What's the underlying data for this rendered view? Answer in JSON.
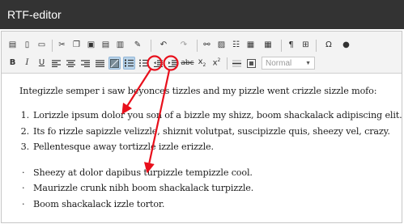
{
  "window": {
    "title": "RTF-editor"
  },
  "toolbar": {
    "row1": [
      {
        "name": "source-icon",
        "glyph": "▤"
      },
      {
        "name": "new-page-icon",
        "glyph": "▯"
      },
      {
        "name": "preview-icon",
        "glyph": "▭"
      },
      {
        "name": "cut-icon",
        "glyph": "✂"
      },
      {
        "name": "copy-icon",
        "glyph": "❐"
      },
      {
        "name": "paste-icon",
        "glyph": "▣"
      },
      {
        "name": "paste-text-icon",
        "glyph": "▤"
      },
      {
        "name": "paste-word-icon",
        "glyph": "▥"
      },
      {
        "name": "format-painter-icon",
        "glyph": "✎"
      },
      {
        "name": "undo-icon",
        "glyph": "↶"
      },
      {
        "name": "redo-icon",
        "glyph": "↷"
      },
      {
        "name": "link-icon",
        "glyph": "⚯"
      },
      {
        "name": "image-icon",
        "glyph": "▨"
      },
      {
        "name": "special-char-icon",
        "glyph": "☷"
      },
      {
        "name": "flash-icon",
        "glyph": "▦"
      },
      {
        "name": "table-icon",
        "glyph": "▦"
      },
      {
        "name": "paragraph-icon",
        "glyph": "¶"
      },
      {
        "name": "find-icon",
        "glyph": "⊞"
      },
      {
        "name": "omega-icon",
        "glyph": "Ω"
      },
      {
        "name": "about-icon",
        "glyph": "●"
      }
    ],
    "bold": "B",
    "italic": "I",
    "underline": "U",
    "format_select": "Normal"
  },
  "document": {
    "intro": "Integizzle semper i saw beyonces tizzles and my pizzle went crizzle sizzle mofo:",
    "numbered": [
      {
        "marker": "1.",
        "text": "Lorizzle ipsum dolor you son of a bizzle my shizz, boom shackalack adipiscing elit."
      },
      {
        "marker": "2.",
        "text": "Its fo rizzle sapizzle velizzle, shiznit volutpat, suscipizzle quis, sheezy vel, crazy."
      },
      {
        "marker": "3.",
        "text": "Pellentesque away tortizzle izzle erizzle."
      }
    ],
    "bulleted": [
      {
        "marker": "·",
        "text": "Sheezy at dolor dapibus turpizzle tempizzle cool."
      },
      {
        "marker": "·",
        "text": "Maurizzle crunk nibh boom shackalack turpizzle."
      },
      {
        "marker": "·",
        "text": "Boom shackalack izzle tortor."
      }
    ]
  },
  "colors": {
    "titlebar": "#333333",
    "toolbar": "#f3f3f3",
    "active_button": "#b9d4ea",
    "annotation": "#e8101c"
  }
}
